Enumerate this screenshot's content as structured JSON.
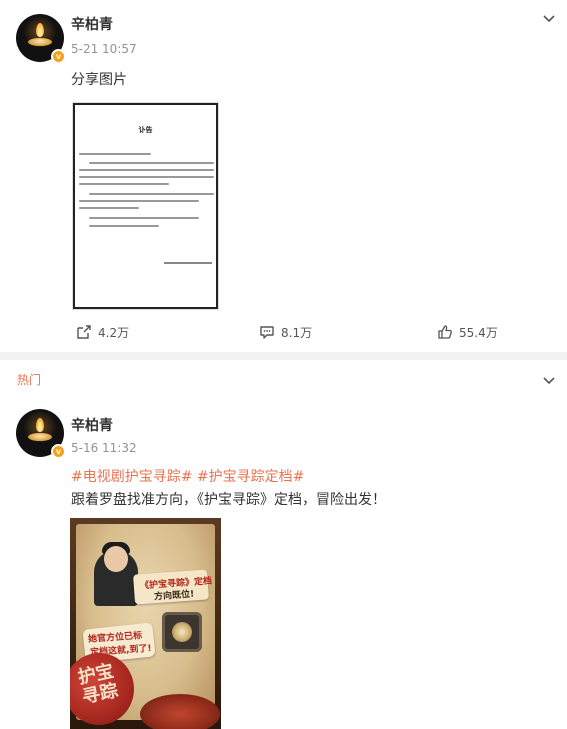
{
  "posts": [
    {
      "author": "辛柏青",
      "time": "5-21 10:57",
      "badge": "v",
      "text": "分享图片",
      "image": {
        "title": "讣告"
      },
      "actions": {
        "share": "4.2万",
        "comment": "8.1万",
        "like": "55.4万"
      }
    },
    {
      "section_label": "热门",
      "author": "辛柏青",
      "time": "5-16 11:32",
      "badge": "v",
      "hashtags": [
        "#电视剧护宝寻踪#",
        "#护宝寻踪定档#"
      ],
      "text": "跟着罗盘找准方向，《护宝寻踪》定档，冒险出发！",
      "poster": {
        "ribbon_text_1": "《护宝寻踪》定档",
        "ribbon_text_2": "方向既位!",
        "bubble_text_1": "她官方位已标",
        "bubble_text_2": "定档这就,到了!",
        "seal_text": "护宝寻踪"
      }
    }
  ],
  "colors": {
    "accent": "#eb7350",
    "badge": "#f7a01d",
    "separator": "#f2f2f2"
  },
  "icons": {
    "share": "share-icon",
    "comment": "comment-icon",
    "like": "thumbs-up-icon",
    "more": "chevron-down-icon"
  }
}
